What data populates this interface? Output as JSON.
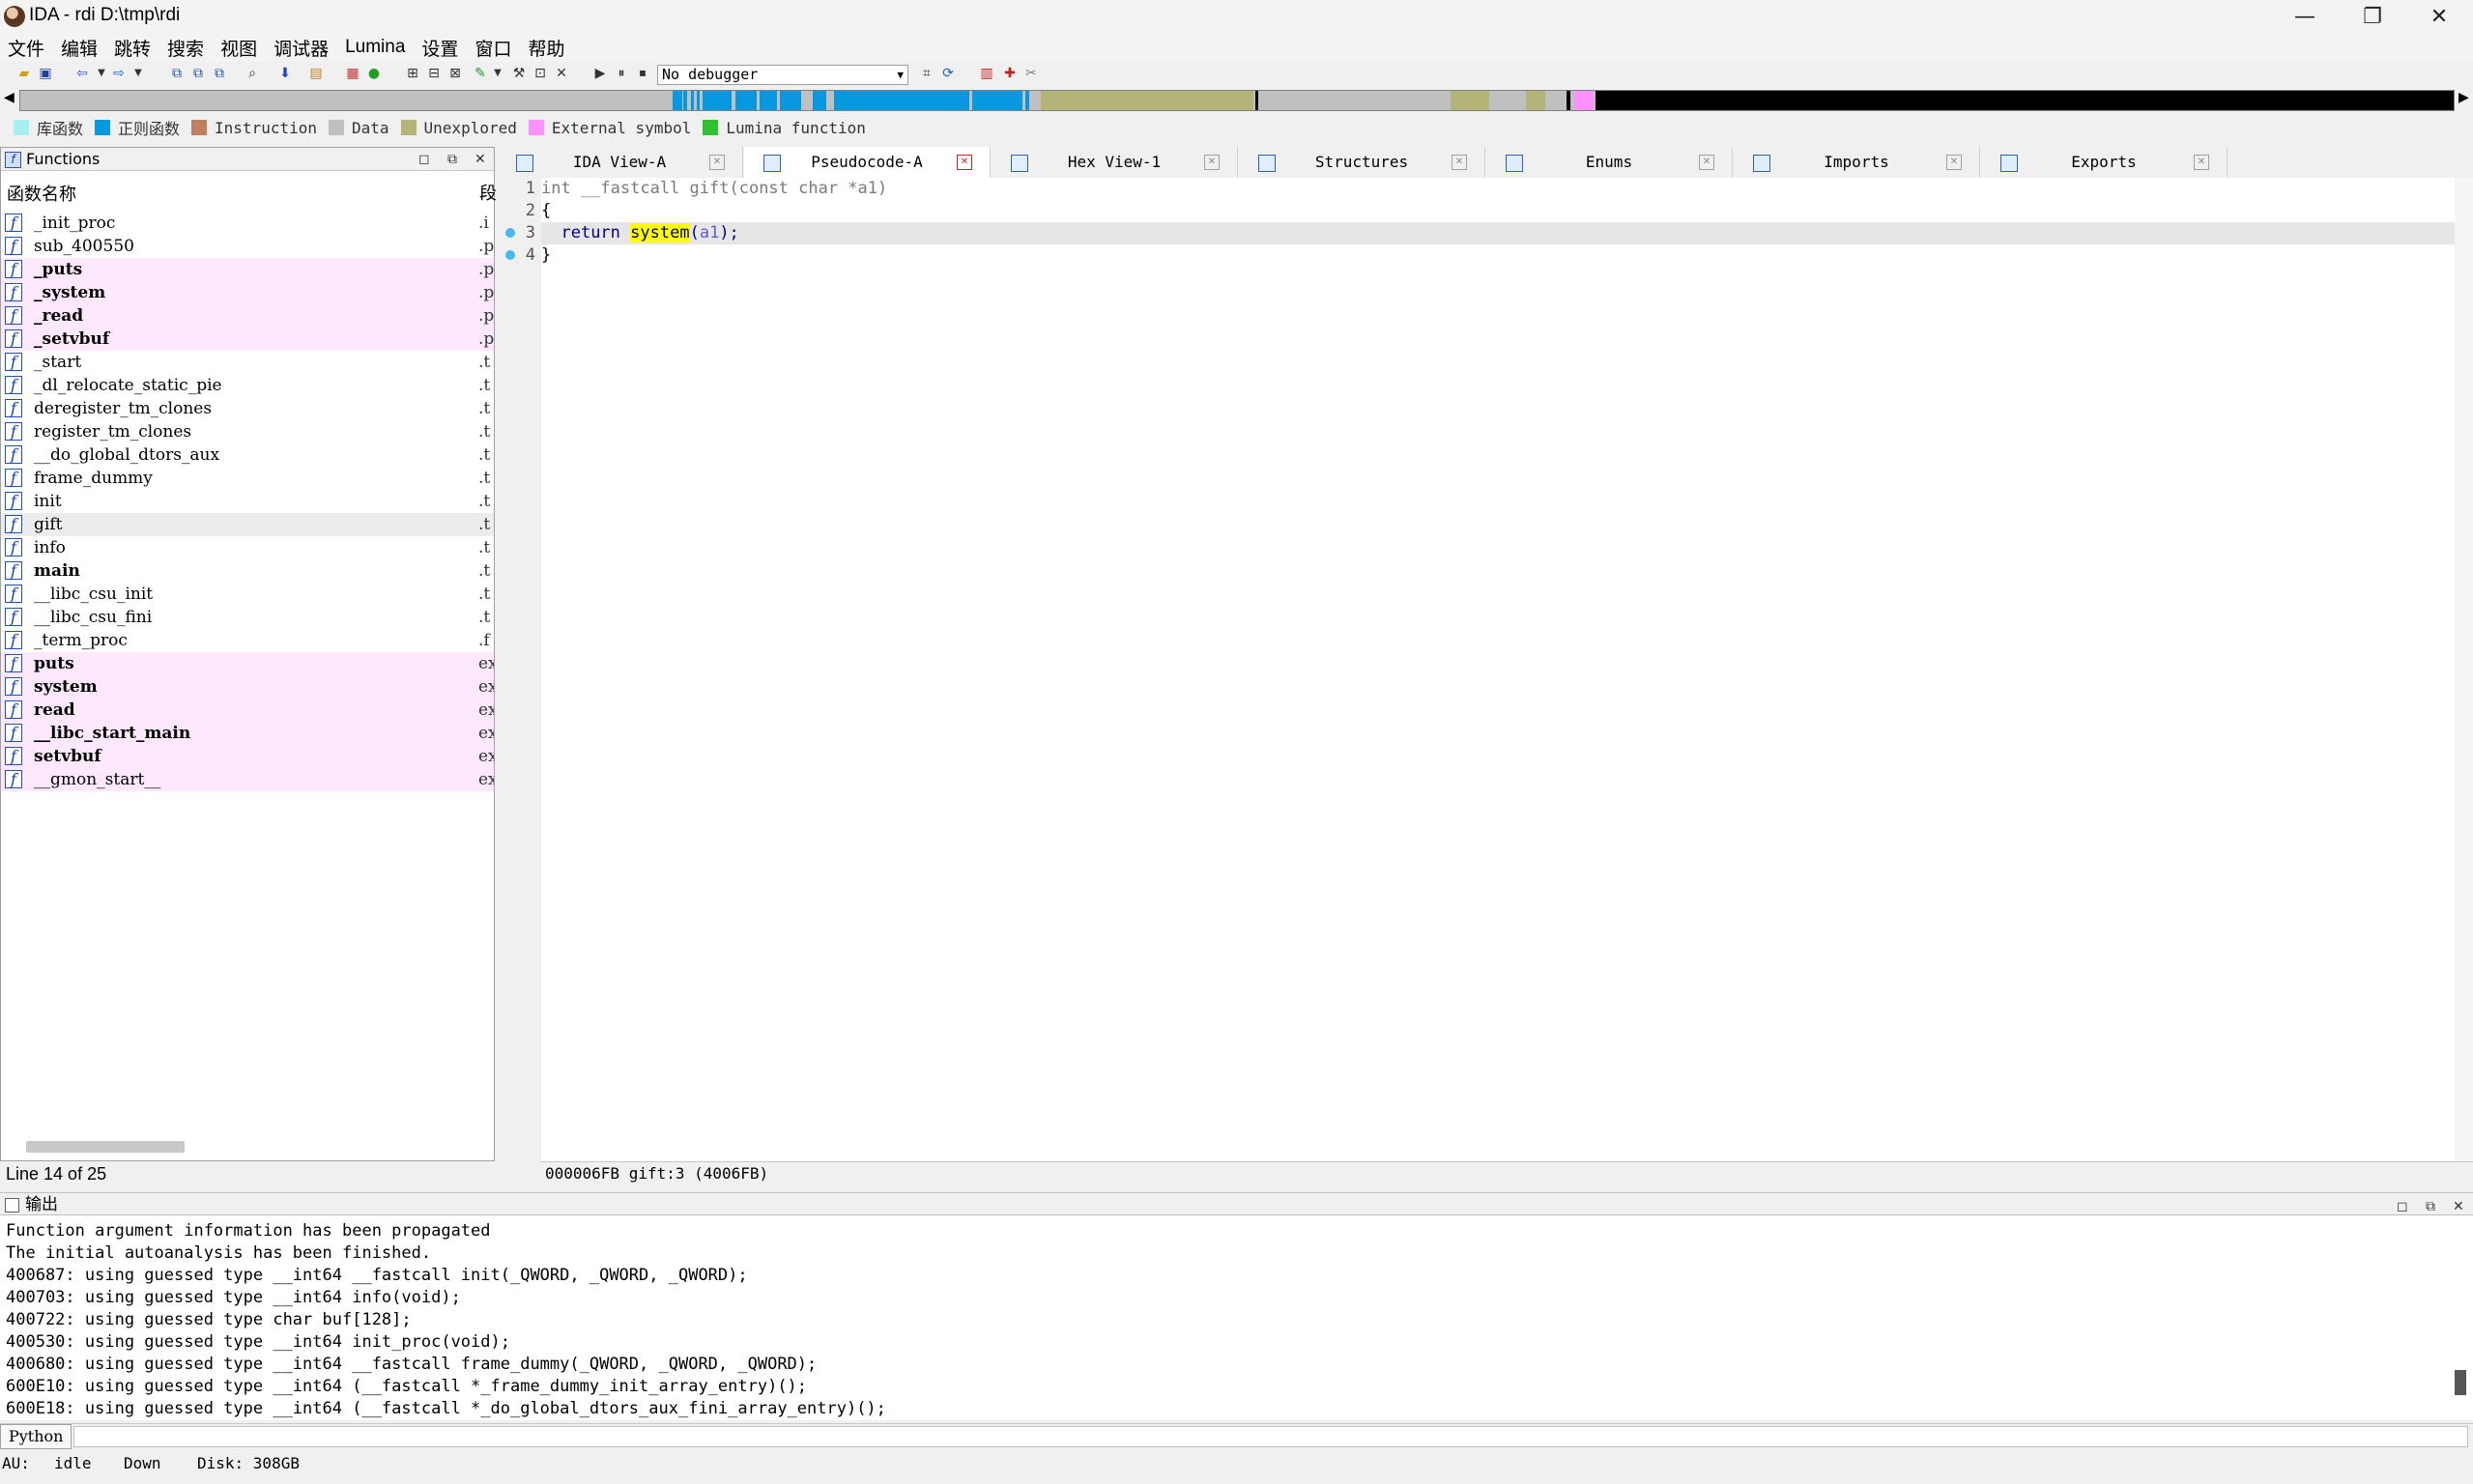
{
  "window": {
    "title": "IDA - rdi D:\\tmp\\rdi"
  },
  "window_controls": {
    "minimize": "—",
    "maximize": "❐",
    "close": "✕"
  },
  "menu": [
    "文件",
    "编辑",
    "跳转",
    "搜索",
    "视图",
    "调试器",
    "Lumina",
    "设置",
    "窗口",
    "帮助"
  ],
  "toolbar": {
    "debugger_select": "No debugger"
  },
  "legend": [
    {
      "label": "库函数",
      "color": "#a8f0f0"
    },
    {
      "label": "正则函数",
      "color": "#0898e0"
    },
    {
      "label": "Instruction",
      "color": "#c08060"
    },
    {
      "label": "Data",
      "color": "#c0c0c0"
    },
    {
      "label": "Unexplored",
      "color": "#b4b478"
    },
    {
      "label": "External symbol",
      "color": "#ff90ff"
    },
    {
      "label": "Lumina function",
      "color": "#30c030"
    }
  ],
  "functions_panel": {
    "title": "Functions",
    "col_name": "函数名称",
    "col_segment": "段",
    "status": "Line 14 of 25",
    "items": [
      {
        "name": "_init_proc",
        "seg": ".i",
        "kind": "normal",
        "bold": false
      },
      {
        "name": "sub_400550",
        "seg": ".p",
        "kind": "normal",
        "bold": false
      },
      {
        "name": "_puts",
        "seg": ".p",
        "kind": "ext",
        "bold": true
      },
      {
        "name": "_system",
        "seg": ".p",
        "kind": "ext",
        "bold": true
      },
      {
        "name": "_read",
        "seg": ".p",
        "kind": "ext",
        "bold": true
      },
      {
        "name": "_setvbuf",
        "seg": ".p",
        "kind": "ext",
        "bold": true
      },
      {
        "name": "_start",
        "seg": ".t",
        "kind": "normal",
        "bold": false
      },
      {
        "name": "_dl_relocate_static_pie",
        "seg": ".t",
        "kind": "normal",
        "bold": false
      },
      {
        "name": "deregister_tm_clones",
        "seg": ".t",
        "kind": "normal",
        "bold": false
      },
      {
        "name": "register_tm_clones",
        "seg": ".t",
        "kind": "normal",
        "bold": false
      },
      {
        "name": "__do_global_dtors_aux",
        "seg": ".t",
        "kind": "normal",
        "bold": false
      },
      {
        "name": "frame_dummy",
        "seg": ".t",
        "kind": "normal",
        "bold": false
      },
      {
        "name": "init",
        "seg": ".t",
        "kind": "normal",
        "bold": false
      },
      {
        "name": "gift",
        "seg": ".t",
        "kind": "sel",
        "bold": false
      },
      {
        "name": "info",
        "seg": ".t",
        "kind": "normal",
        "bold": false
      },
      {
        "name": "main",
        "seg": ".t",
        "kind": "normal",
        "bold": true
      },
      {
        "name": "__libc_csu_init",
        "seg": ".t",
        "kind": "normal",
        "bold": false
      },
      {
        "name": "__libc_csu_fini",
        "seg": ".t",
        "kind": "normal",
        "bold": false
      },
      {
        "name": "_term_proc",
        "seg": ".f",
        "kind": "normal",
        "bold": false
      },
      {
        "name": "puts",
        "seg": "ex",
        "kind": "ext",
        "bold": true
      },
      {
        "name": "system",
        "seg": "ex",
        "kind": "ext",
        "bold": true
      },
      {
        "name": "read",
        "seg": "ex",
        "kind": "ext",
        "bold": true
      },
      {
        "name": "__libc_start_main",
        "seg": "ex",
        "kind": "ext",
        "bold": true
      },
      {
        "name": "setvbuf",
        "seg": "ex",
        "kind": "ext",
        "bold": true
      },
      {
        "name": "__gmon_start__",
        "seg": "ex",
        "kind": "ext",
        "bold": false
      }
    ]
  },
  "tabs": [
    {
      "label": "IDA View-A",
      "active": false
    },
    {
      "label": "Pseudocode-A",
      "active": true
    },
    {
      "label": "Hex View-1",
      "active": false
    },
    {
      "label": "Structures",
      "active": false
    },
    {
      "label": "Enums",
      "active": false
    },
    {
      "label": "Imports",
      "active": false
    },
    {
      "label": "Exports",
      "active": false
    }
  ],
  "pseudocode": {
    "lines": [
      {
        "num": "1",
        "breakpoint": false
      },
      {
        "num": "2",
        "breakpoint": false
      },
      {
        "num": "3",
        "breakpoint": true
      },
      {
        "num": "4",
        "breakpoint": true
      }
    ],
    "sig_type": "int __fastcall ",
    "sig_name": "gift",
    "sig_params": "(const char *a1)",
    "open_brace": "{",
    "ret_kw": "return",
    "ret_func": "system",
    "ret_paren_open": "(",
    "ret_arg": "a1",
    "ret_tail": ");",
    "close_brace": "}",
    "status": "000006FB gift:3 (4006FB)"
  },
  "output": {
    "title": "输出",
    "lines": [
      "Function argument information has been propagated",
      "The initial autoanalysis has been finished.",
      "400687: using guessed type __int64 __fastcall init(_QWORD, _QWORD, _QWORD);",
      "400703: using guessed type __int64 info(void);",
      "400722: using guessed type char buf[128];",
      "400530: using guessed type __int64 init_proc(void);",
      "400680: using guessed type __int64 __fastcall frame_dummy(_QWORD, _QWORD, _QWORD);",
      "600E10: using guessed type __int64 (__fastcall *_frame_dummy_init_array_entry)();",
      "600E18: using guessed type __int64 (__fastcall *_do_global_dtors_aux_fini_array_entry)();"
    ],
    "python_label": "Python"
  },
  "statusbar": {
    "au_label": "AU:",
    "au_state": "idle",
    "direction": "Down",
    "disk": "Disk: 308GB"
  }
}
